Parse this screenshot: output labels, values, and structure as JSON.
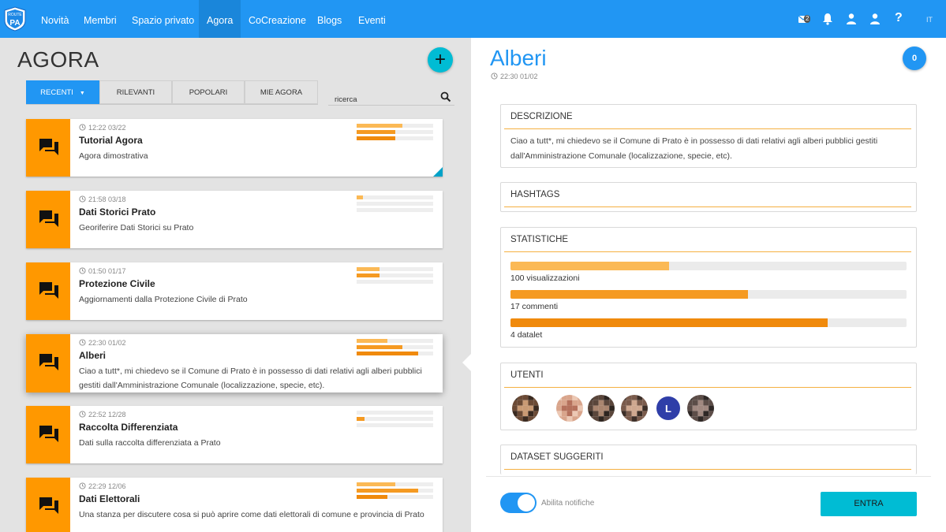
{
  "nav": {
    "logo_text": "ROUTE-TO-PA",
    "items": [
      {
        "label": "Novità"
      },
      {
        "label": "Membri"
      },
      {
        "label": "Spazio privato"
      },
      {
        "label": "Agora",
        "active": true
      },
      {
        "label": "CoCreazione"
      },
      {
        "label": "Blogs"
      },
      {
        "label": "Eventi"
      }
    ],
    "messages_count": "2",
    "icons": [
      "messages-icon",
      "bell-icon",
      "user-icon",
      "user-icon",
      "help-icon"
    ],
    "help_label": "?",
    "lang": "IT",
    "color": "#2196f3"
  },
  "agora": {
    "title": "AGORA",
    "add_label": "+",
    "tabs": [
      {
        "label": "RECENTI",
        "active": true
      },
      {
        "label": "RILEVANTI"
      },
      {
        "label": "POPOLARI"
      },
      {
        "label": "MIE AGORA"
      }
    ],
    "search_placeholder": "ricerca",
    "rooms": [
      {
        "time": "12:22 03/22",
        "title": "Tutorial Agora",
        "desc": "Agora dimostrativa",
        "bars": [
          0.6,
          0.5,
          0.5
        ],
        "flag": true
      },
      {
        "time": "21:58 03/18",
        "title": "Dati Storici Prato",
        "desc": "Georiferire Dati Storici su Prato",
        "bars": [
          0.08,
          0,
          0
        ]
      },
      {
        "time": "01:50 01/17",
        "title": "Protezione Civile",
        "desc": "Aggiornamenti dalla Protezione Civile di Prato",
        "bars": [
          0.3,
          0.3,
          0
        ]
      },
      {
        "time": "22:30 01/02",
        "title": "Alberi",
        "desc": "Ciao a tutt*, mi chiedevo se il Comune di Prato è in possesso di dati relativi agli alberi pubblici gestiti dall'Amministrazione Comunale (localizzazione, specie, etc).",
        "bars": [
          0.4,
          0.6,
          0.8
        ],
        "selected": true
      },
      {
        "time": "22:52 12/28",
        "title": "Raccolta Differenziata",
        "desc": "Dati sulla raccolta differenziata a Prato",
        "bars": [
          0,
          0.1,
          0
        ]
      },
      {
        "time": "22:29 12/06",
        "title": "Dati Elettorali",
        "desc": "Una stanza per discutere cosa si può aprire come dati elettorali di comune e provincia di Prato",
        "bars": [
          0.5,
          0.8,
          0.4
        ]
      }
    ],
    "accent": "#ff9800",
    "bar_colors": [
      "#fbb955",
      "#f59a22",
      "#f08a0c"
    ]
  },
  "detail": {
    "title": "Alberi",
    "time": "22:30 01/02",
    "badge": "0",
    "description_head": "DESCRIZIONE",
    "description": "Ciao a tutt*, mi chiedevo se il Comune di Prato è in possesso di dati relativi agli alberi pubblici gestiti dall'Amministrazione Comunale (localizzazione, specie, etc).",
    "hashtags_head": "HASHTAGS",
    "stats_head": "STATISTICHE",
    "stats": [
      {
        "label": "100 visualizzazioni",
        "fraction": 0.4,
        "color": "#fbb955"
      },
      {
        "label": "17 commenti",
        "fraction": 0.6,
        "color": "#f59a22"
      },
      {
        "label": "4 datalet",
        "fraction": 0.8,
        "color": "#f08a0c"
      }
    ],
    "users_head": "UTENTI",
    "users": [
      {
        "type": "photo"
      },
      {
        "type": "photo"
      },
      {
        "type": "photo"
      },
      {
        "type": "photo"
      },
      {
        "type": "letter",
        "letter": "L"
      },
      {
        "type": "photo"
      }
    ],
    "datasets_head": "DATASET SUGGERITI",
    "notify_label": "Abilita notifiche",
    "notify_on": true,
    "enter_label": "ENTRA"
  }
}
